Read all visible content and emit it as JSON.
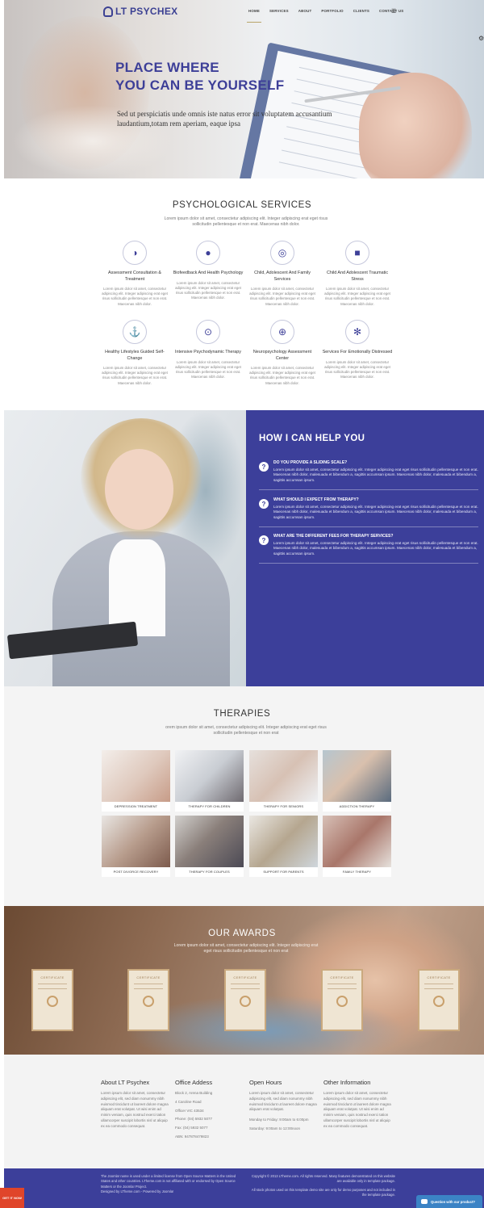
{
  "header": {
    "logo": "LT PSYCHEX",
    "nav": [
      "HOME",
      "SERVICES",
      "ABOUT",
      "PORTFOLIO",
      "CLIENTS",
      "CONTACT US"
    ],
    "menu_icon": "hamburger-icon"
  },
  "hero": {
    "title_line1": "PLACE WHERE",
    "title_line2": "YOU CAN BE YOURSELF",
    "subtitle": "Sed ut perspiciatis unde omnis iste natus error sit voluptatem accusantium laudantium,totam rem aperiam, eaque ipsa"
  },
  "services": {
    "title": "PSYCHOLOGICAL SERVICES",
    "intro": "Lorem ipsum dolor sit amet, consectetur adipiscing elit. Integer adipiscing erat eget risus sollicitudin pellentesque et non erat. Maecenas nibh dolor.",
    "desc": "Lorem ipsum dolor sit amet, consectetur adipiscing elit. Integer adipiscing erat eget risus sollicitudin pellentesque et non erat. Maecenas nibh dolor.",
    "items": [
      {
        "title": "Assessment Consultation & Treatment",
        "icon": "half-circle-icon"
      },
      {
        "title": "Biofeedback And Health Psychology",
        "icon": "bomb-icon"
      },
      {
        "title": "Child, Adolescent And Family Services",
        "icon": "target-icon"
      },
      {
        "title": "Child And Adolescent Traumatic Stress",
        "icon": "ambulance-icon"
      },
      {
        "title": "Healthy Lifestyles Guided Self-Change",
        "icon": "anchor-icon"
      },
      {
        "title": "Intensive Psychodynamic Therapy",
        "icon": "circle-dot-icon"
      },
      {
        "title": "Neuropsychology Assessment Center",
        "icon": "basketball-icon"
      },
      {
        "title": "Services For Emotionally Distressed",
        "icon": "snowflake-icon"
      }
    ]
  },
  "help": {
    "title": "HOW I CAN HELP YOU",
    "faqs": [
      {
        "q": "DO YOU PROVIDE A SLIDING SCALE?",
        "a": "Lorem ipsum dolor sit amet, consectetur adipiscing elit. Integer adipiscing erat eget risus sollicitudin pellentesque et non erat. Maecenas nibh dolor, malesuada et bibendum a, sagittis accumsan ipsum. Maecenas nibh dolor, malesuada et bibendum a, sagittis accumsan ipsum."
      },
      {
        "q": "WHAT SHOULD I EXPECT FROM THERAPY?",
        "a": "Lorem ipsum dolor sit amet, consectetur adipiscing elit. Integer adipiscing erat eget risus sollicitudin pellentesque et non erat. Maecenas nibh dolor, malesuada et bibendum a, sagittis accumsan ipsum. Maecenas nibh dolor, malesuada et bibendum a, sagittis accumsan ipsum."
      },
      {
        "q": "WHAT ARE THE DIFFERENT FEES FOR THERAPY SERVICES?",
        "a": "Lorem ipsum dolor sit amet, consectetur adipiscing elit. Integer adipiscing erat eget risus sollicitudin pellentesque et non erat. Maecenas nibh dolor, malesuada et bibendum a, sagittis accumsan ipsum. Maecenas nibh dolor, malesuada et bibendum a, sagittis accumsan ipsum."
      }
    ]
  },
  "therapies": {
    "title": "THERAPIES",
    "intro": "orem ipsum dolor sit amet, consectetur adipiscing elit. Integer adipiscing erat eget risus sollicitudin pellentesque et non erat",
    "items": [
      "DEPRESSION TREATMENT",
      "THERAPY FOR CHILDREN",
      "THERAPY FOR SENIORS",
      "ADDICTION THERAPY",
      "POST DIVORCE RECOVERY",
      "THERAPY FOR COUPLES",
      "SUPPORT FOR PARENTS",
      "FAMILY THERAPY"
    ]
  },
  "awards": {
    "title": "OUR AWARDS",
    "intro": "Lorem ipsum dolor sit amet, consectetur adipiscing elit. Integer adipiscing erat eget risus sollicitudin pellentesque et non erat",
    "cert_label": "CERTIFICATE"
  },
  "footer": {
    "about": {
      "title": "About LT Psychex",
      "text": "Lorem ipsum dolor sit amet, consectetur adipiscing elit, sed diam nonummy nibh euismod tincidunt ut laoreet dolore magna aliquam erat volutpat. Ut wisi enim ad minim veniam, quis nostrud exerci tation ullamcorper suscipit lobortis nisl ut aliquip ex ea commodo consequat."
    },
    "office": {
      "title": "Office Addess",
      "lines": [
        "Block 2, Arena Building",
        "4 Caroline Road",
        "Officer VIC 43534",
        "Phone: (04) 5932 5077",
        "Fax: (04) 5932 5077",
        "ABN: 947878479823"
      ]
    },
    "hours": {
      "title": "Open Hours",
      "text": "Lorem ipsum dolor sit amet, consectetur adipiscing elit, sed diam nonummy nibh euismod tincidunt ut laoreet dolore magna aliquam erat volutpat.",
      "line1": "Monday to Friday: 9:00am to 6:00pm",
      "line2": "Saturday: 9:00am to 12:00noon"
    },
    "other": {
      "title": "Other Information",
      "text": "Lorem ipsum dolor sit amet, consectetur adipiscing elit, sed diam nonummy nibh euismod tincidunt ut laoreet dolore magna aliquam erat volutpat. Ut wisi enim ad minim veniam, quis nostrud exerci tation ullamcorper suscipit lobortis nisl ut aliquip ex ea commodo consequat."
    }
  },
  "bottom": {
    "left": "The Joomla! name is used under a limited license from Open Source Matters in the United States and other countries. LTheme.com is not affiliated with or endorsed by Open Source Matters or the Joomla! Project.",
    "left2": "Designed by LTheme.com - Powered by Joomla!",
    "right": "Copyright © 2013 LTheme.com. All rights reserved. Many features demonstrated on this website are available only in template package.",
    "right2": "All stock photos used on this template demo site are only for demo purposes and not included in the template package.",
    "ribbon": "GET IT NOW",
    "chat": "Question with our product?"
  }
}
